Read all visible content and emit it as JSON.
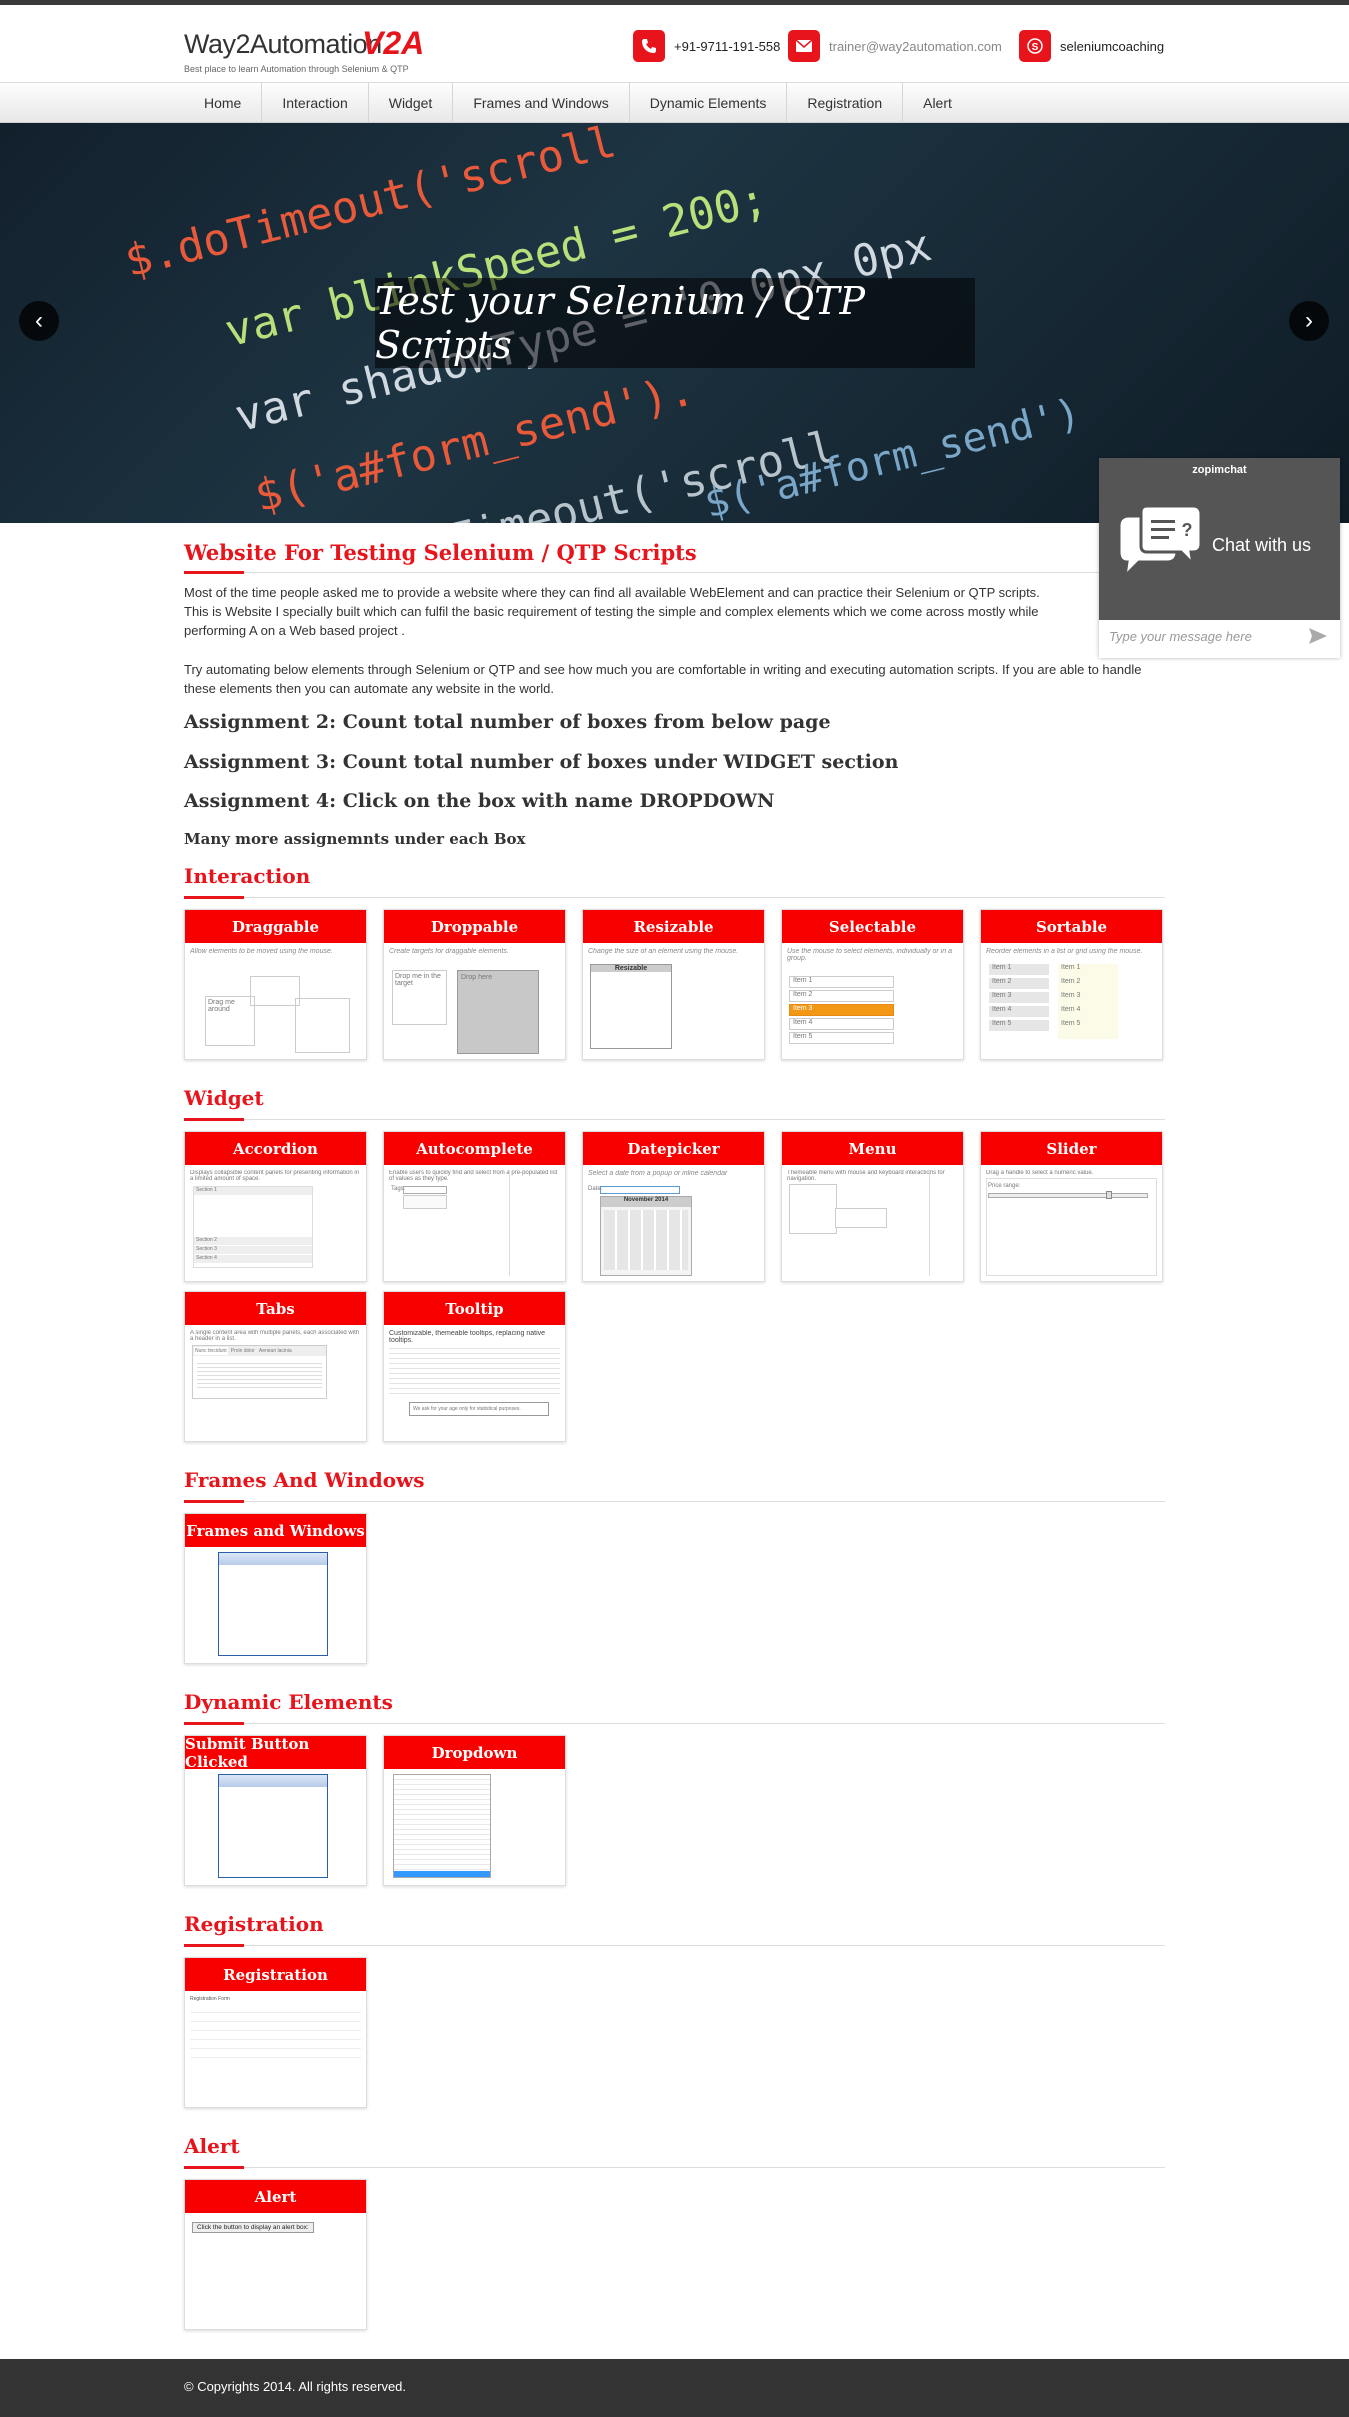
{
  "header": {
    "logo_text": "Way2Automation",
    "logo_mark": "V2A",
    "tagline": "Best place to learn Automation through Selenium & QTP",
    "phone": "+91-9711-191-558",
    "email": "trainer@way2automation.com",
    "skype": "seleniumcoaching"
  },
  "nav": [
    "Home",
    "Interaction",
    "Widget",
    "Frames and Windows",
    "Dynamic Elements",
    "Registration",
    "Alert"
  ],
  "hero": {
    "caption": "Test your Selenium / QTP Scripts",
    "code_lines": [
      "$.doTimeout('scroll",
      "var blinkSpeed = 200;",
      "var shadowType = '0 0px 0px",
      "$('a#form_send').",
      "$.doTimeout('scroll",
      "$('a#form_send')"
    ],
    "prev": "‹",
    "next": "›"
  },
  "chat": {
    "brand": "zopimchat",
    "title": "Chat with us",
    "placeholder": "Type your message here"
  },
  "intro": {
    "title": "Website For Testing Selenium / QTP Scripts",
    "p1": "Most of the time people asked me to provide a website where they can find all available WebElement and can practice their Selenium or QTP scripts. This is Website I specially built which can fulfil the basic requirement of testing the simple and complex elements which we come across mostly while performing A on a Web based project .",
    "p2": "Try automating below elements through Selenium or QTP and see how much you are comfortable in writing and executing automation scripts. If you are able to handle these elements then you can automate any website in the world.",
    "a2": "Assignment 2: Count total number of boxes from below page",
    "a3": "Assignment 3: Count total number of boxes under WIDGET section",
    "a4": "Assignment 4: Click on the box with name DROPDOWN",
    "more": "Many more assignemnts under each Box"
  },
  "sections": {
    "interaction": {
      "title": "Interaction",
      "cards": [
        {
          "title": "Draggable",
          "desc": "Allow elements to be moved using the mouse."
        },
        {
          "title": "Droppable",
          "desc": "Create targets for draggable elements."
        },
        {
          "title": "Resizable",
          "desc": "Change the size of an element using the mouse."
        },
        {
          "title": "Selectable",
          "desc": "Use the mouse to select elements, individually or in a group."
        },
        {
          "title": "Sortable",
          "desc": "Reorder elements in a list or grid using the mouse."
        }
      ]
    },
    "widget": {
      "title": "Widget",
      "cards": [
        {
          "title": "Accordion",
          "desc": "Displays collapsible content panels for presenting information in a limited amount of space."
        },
        {
          "title": "Autocomplete",
          "desc": "Enable users to quickly find and select from a pre-populated list of values as they type."
        },
        {
          "title": "Datepicker",
          "desc": "Select a date from a popup or inline calendar"
        },
        {
          "title": "Menu",
          "desc": "Themeable menu with mouse and keyboard interactions for navigation."
        },
        {
          "title": "Slider",
          "desc": "Drag a handle to select a numeric value."
        },
        {
          "title": "Tabs",
          "desc": "A single content area with multiple panels, each associated with a header in a list."
        },
        {
          "title": "Tooltip",
          "desc": "Customizable, themeable tooltips, replacing native tooltips."
        }
      ]
    },
    "frames": {
      "title": "Frames And Windows",
      "cards": [
        {
          "title": "Frames and Windows",
          "desc": ""
        }
      ]
    },
    "dynamic": {
      "title": "Dynamic Elements",
      "cards": [
        {
          "title": "Submit Button Clicked",
          "desc": ""
        },
        {
          "title": "Dropdown",
          "desc": ""
        }
      ]
    },
    "registration": {
      "title": "Registration",
      "cards": [
        {
          "title": "Registration",
          "desc": "Registration Form"
        }
      ]
    },
    "alert": {
      "title": "Alert",
      "cards": [
        {
          "title": "Alert",
          "desc": "Click the button to display an alert box:"
        }
      ]
    }
  },
  "previews": {
    "drag_small": "Drag me around",
    "drop_target": "Drop me in the target",
    "drop_item": "Drop here",
    "resize_label": "Resizable",
    "select_items": [
      "Item 1",
      "Item 2",
      "Item 3",
      "Item 4",
      "Item 5"
    ],
    "sort_items": [
      "Item 1",
      "Item 2",
      "Item 3",
      "Item 4",
      "Item 5"
    ],
    "accordion_sections": [
      "Section 1",
      "Section 2",
      "Section 3",
      "Section 4"
    ],
    "autocomplete_label": "Tags:",
    "datepicker_month": "November 2014",
    "datepicker_label": "Date:",
    "slider_label": "Price range:",
    "tabs": [
      "Nunc tincidunt",
      "Proin dolor",
      "Aenean lacinia"
    ],
    "tooltip_button": "We ask for your age only for statistical purposes.",
    "alert_button": "Click the button to display an alert box:"
  },
  "footer": {
    "copyright": "© Copyrights 2014. All rights reserved."
  }
}
